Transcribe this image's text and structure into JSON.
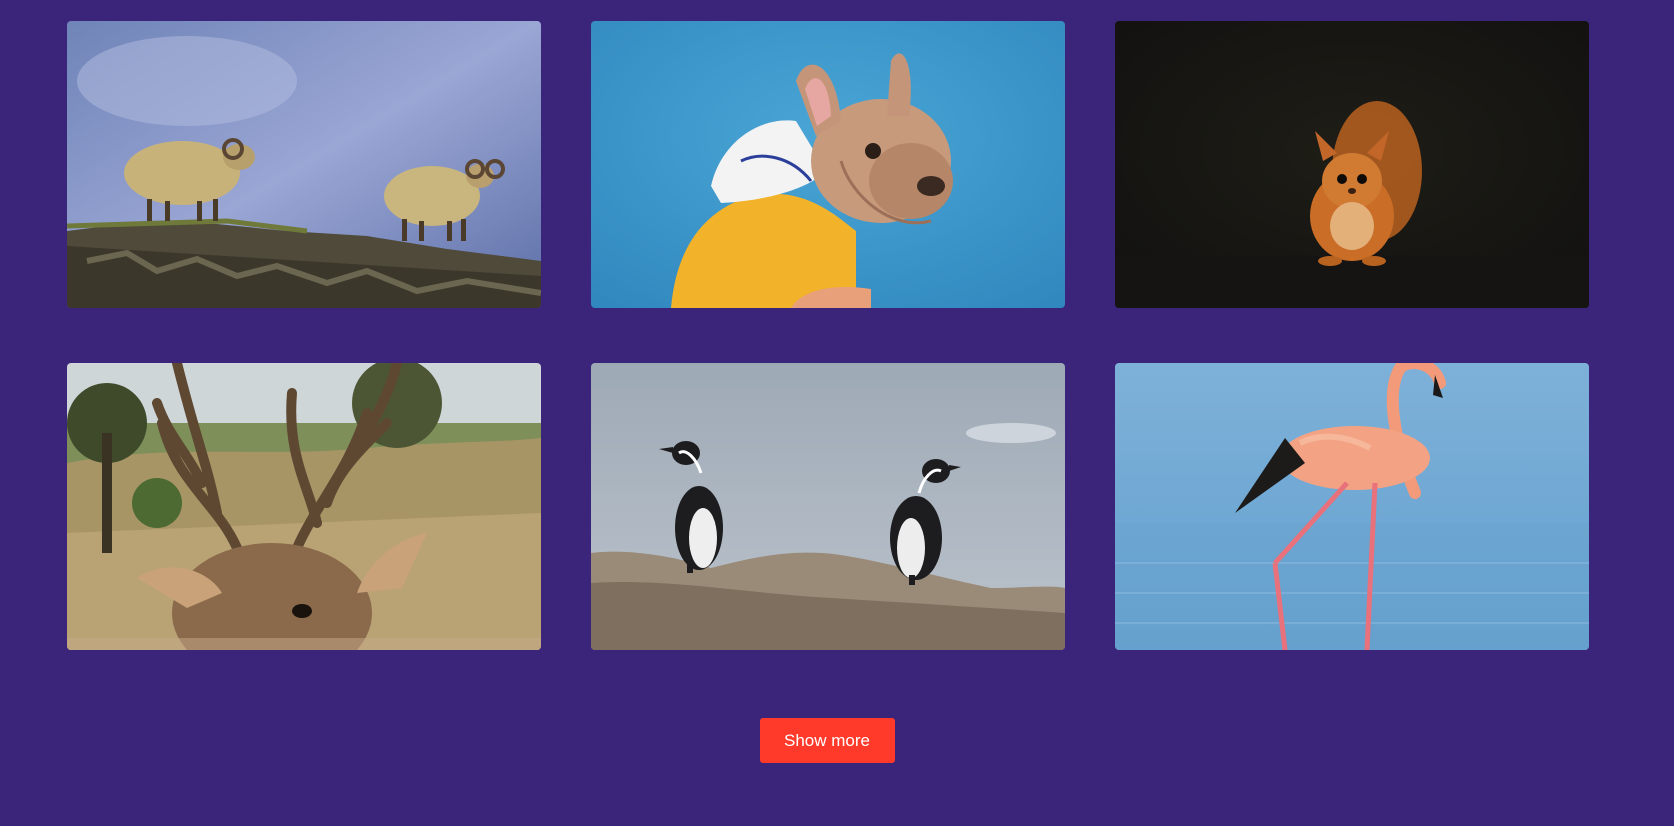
{
  "gallery": {
    "items": [
      {
        "subject": "sheep",
        "icon": "sheep-image"
      },
      {
        "subject": "dog",
        "icon": "dog-image"
      },
      {
        "subject": "squirrel",
        "icon": "squirrel-image"
      },
      {
        "subject": "deer",
        "icon": "deer-image"
      },
      {
        "subject": "penguins",
        "icon": "penguins-image"
      },
      {
        "subject": "flamingo",
        "icon": "flamingo-image"
      }
    ]
  },
  "actions": {
    "show_more_label": "Show more"
  },
  "colors": {
    "background": "#3a257a",
    "button": "#ff3a2a",
    "button_text": "#ffffff"
  }
}
